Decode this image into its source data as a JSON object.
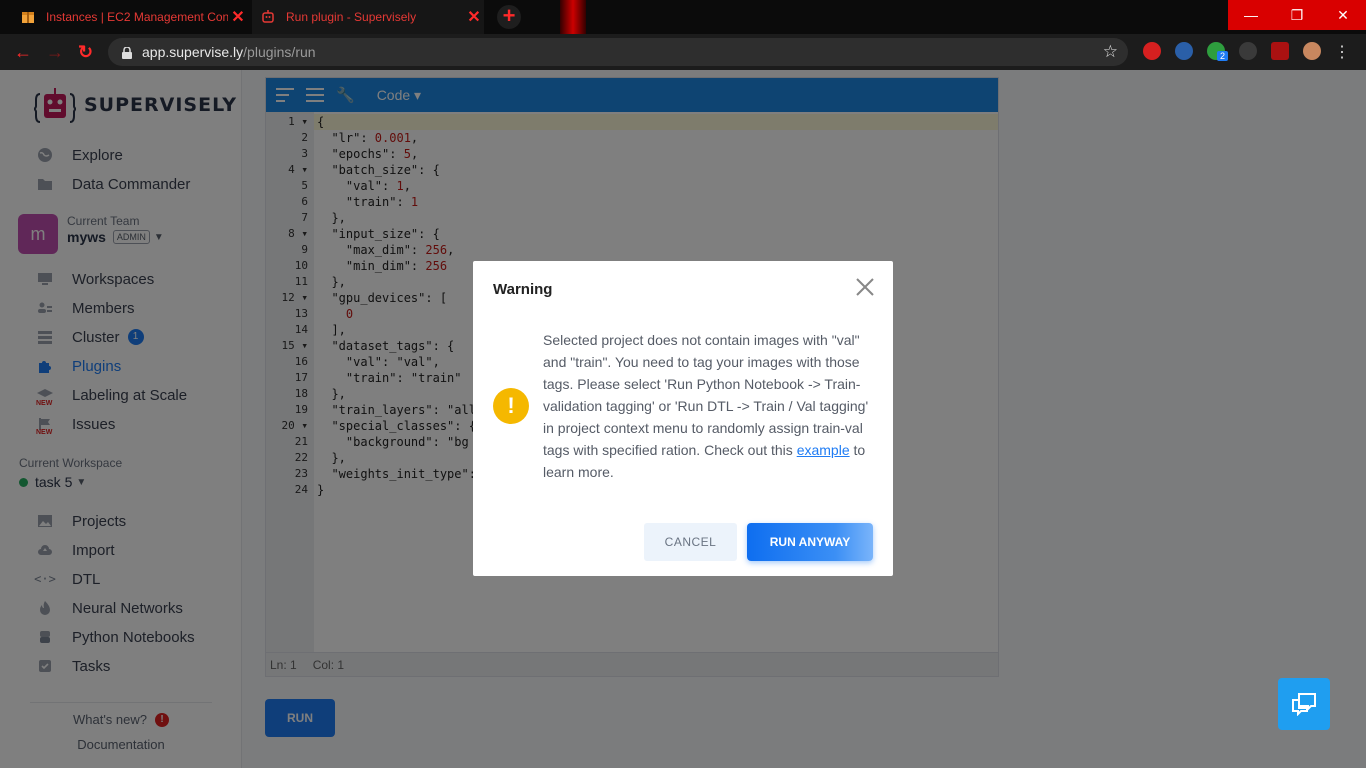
{
  "browser": {
    "tabs": [
      {
        "title": "Instances | EC2 Management Con",
        "close": "✕"
      },
      {
        "title": "Run plugin - Supervisely",
        "close": "✕"
      }
    ],
    "new_tab": "+",
    "window": {
      "minimize": "—",
      "restore": "❐",
      "close": "✕"
    },
    "url_host": "app.supervise.ly",
    "url_path": "/plugins/run",
    "ext_badge": "2"
  },
  "sidebar": {
    "logo": "SUPERVISELY",
    "top_nav": [
      {
        "label": "Explore",
        "icon": "globe-icon"
      },
      {
        "label": "Data Commander",
        "icon": "folder-icon"
      }
    ],
    "team": {
      "label": "Current Team",
      "avatar_letter": "m",
      "name": "myws",
      "role": "ADMIN"
    },
    "team_nav": [
      {
        "label": "Workspaces",
        "icon": "monitor-icon"
      },
      {
        "label": "Members",
        "icon": "members-icon"
      },
      {
        "label": "Cluster",
        "icon": "cluster-icon",
        "badge": "1"
      },
      {
        "label": "Plugins",
        "icon": "puzzle-icon",
        "active": true
      },
      {
        "label": "Labeling at Scale",
        "icon": "graduation-cap-icon",
        "tag": "NEW"
      },
      {
        "label": "Issues",
        "icon": "flag-icon",
        "tag": "NEW"
      }
    ],
    "workspace": {
      "label": "Current Workspace",
      "name": "task 5"
    },
    "ws_nav": [
      {
        "label": "Projects",
        "icon": "image-icon"
      },
      {
        "label": "Import",
        "icon": "cloud-upload-icon"
      },
      {
        "label": "DTL",
        "icon": "code-icon"
      },
      {
        "label": "Neural Networks",
        "icon": "flame-icon"
      },
      {
        "label": "Python Notebooks",
        "icon": "python-icon"
      },
      {
        "label": "Tasks",
        "icon": "checkbox-icon"
      }
    ],
    "whats_new": "What's new?",
    "whats_new_badge": "!",
    "documentation": "Documentation"
  },
  "editor": {
    "menu": "Code",
    "status_ln": "Ln: 1",
    "status_col": "Col: 1",
    "lines": [
      "{",
      "  \"lr\": 0.001,",
      "  \"epochs\": 5,",
      "  \"batch_size\": {",
      "    \"val\": 1,",
      "    \"train\": 1",
      "  },",
      "  \"input_size\": {",
      "    \"max_dim\": 256,",
      "    \"min_dim\": 256",
      "  },",
      "  \"gpu_devices\": [",
      "    0",
      "  ],",
      "  \"dataset_tags\": {",
      "    \"val\": \"val\",",
      "    \"train\": \"train\"",
      "  },",
      "  \"train_layers\": \"all",
      "  \"special_classes\": {",
      "    \"background\": \"bg",
      "  },",
      "  \"weights_init_type\":",
      "}"
    ],
    "folds": [
      1,
      4,
      8,
      12,
      15,
      20
    ]
  },
  "run_button": "RUN",
  "modal": {
    "title": "Warning",
    "icon": "!",
    "message_before": "Selected project does not contain images with \"val\" and \"train\". You need to tag your images with those tags. Please select 'Run Python Notebook -> Train-validation tagging' or 'Run DTL -> Train / Val tagging' in project context menu to randomly assign train-val tags with specified ration. Check out this ",
    "link": "example",
    "message_after": " to learn more.",
    "cancel": "CANCEL",
    "confirm": "RUN ANYWAY"
  },
  "colors": {
    "accent": "#1f7cf4",
    "warning": "#f5b800",
    "chrome_red": "#d90000"
  }
}
